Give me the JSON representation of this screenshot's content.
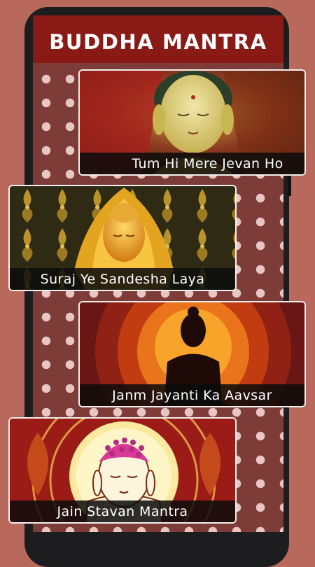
{
  "app": {
    "title": "BUDDHA MANTRA"
  },
  "cards": [
    {
      "title": "Tum Hi Mere Jevan Ho",
      "image": "golden-buddha-face-red-background"
    },
    {
      "title": "Suraj Ye Sandesha Laya",
      "image": "golden-buddha-ornate-pattern"
    },
    {
      "title": "Janm Jayanti Ka Aavsar",
      "image": "buddha-silhouette-sunset"
    },
    {
      "title": "Jain Stavan Mantra",
      "image": "illustrated-buddha-mandala"
    }
  ],
  "colors": {
    "page_background": "#b8695b",
    "app_bar": "#8a1a16",
    "screen_background": "#7d3c37",
    "polka_dot": "#e7c6c3",
    "caption_background": "#0c0c0c",
    "caption_text": "#ffffff"
  }
}
